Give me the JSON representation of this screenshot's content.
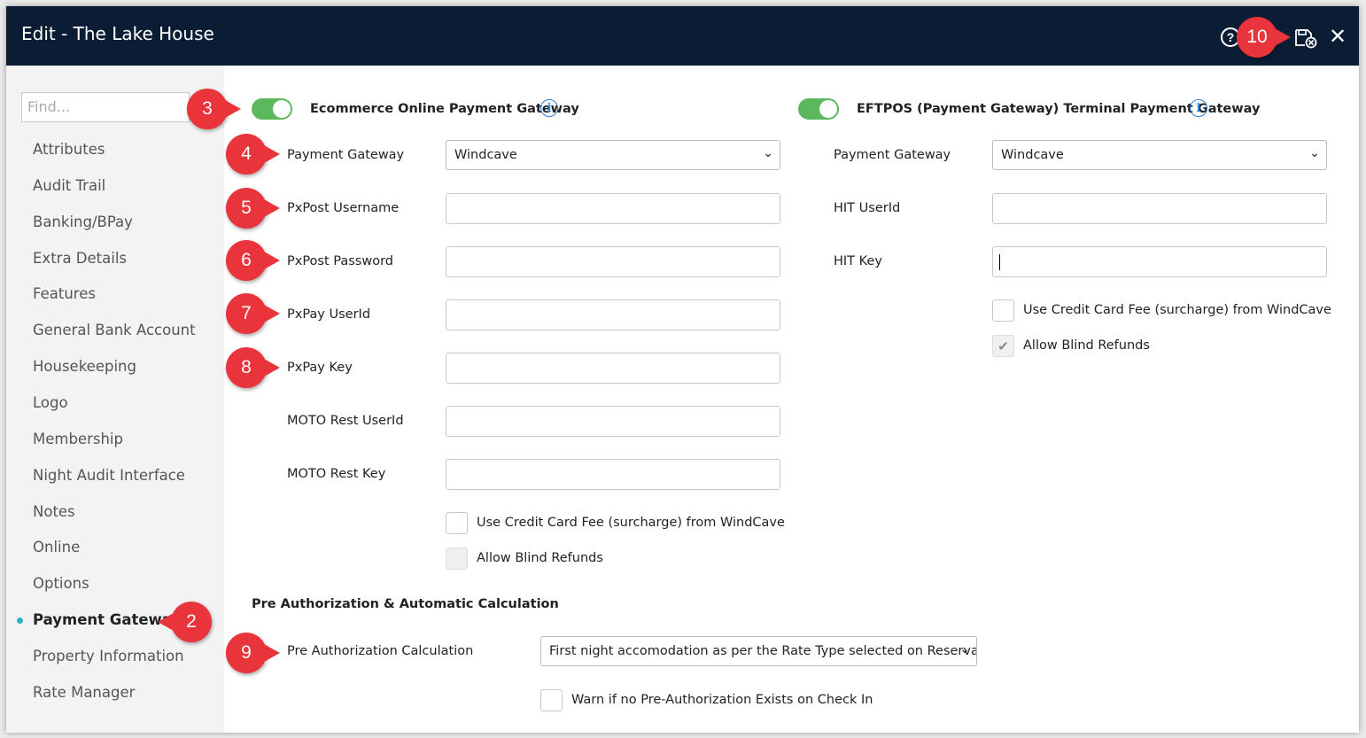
{
  "window": {
    "title": "Edit - The Lake House",
    "help_icon_glyph": "?",
    "close_icon_glyph": "✕"
  },
  "sidebar": {
    "find_placeholder": "Find...",
    "items": [
      {
        "label": "Attributes"
      },
      {
        "label": "Audit Trail"
      },
      {
        "label": "Banking/BPay"
      },
      {
        "label": "Extra Details"
      },
      {
        "label": "Features"
      },
      {
        "label": "General Bank Account"
      },
      {
        "label": "Housekeeping"
      },
      {
        "label": "Logo"
      },
      {
        "label": "Membership"
      },
      {
        "label": "Night Audit Interface"
      },
      {
        "label": "Notes"
      },
      {
        "label": "Online"
      },
      {
        "label": "Options"
      },
      {
        "label": "Payment Gateway"
      },
      {
        "label": "Property Information"
      },
      {
        "label": "Rate Manager"
      }
    ],
    "active_item": "Payment Gateway"
  },
  "ecommerce": {
    "toggle_on": true,
    "heading": "Ecommerce Online Payment Gateway",
    "payment_gateway_label": "Payment Gateway",
    "payment_gateway_value": "Windcave",
    "pxpost_username_label": "PxPost Username",
    "pxpost_password_label": "PxPost Password",
    "pxpay_userid_label": "PxPay UserId",
    "pxpay_key_label": "PxPay Key",
    "moto_userid_label": "MOTO Rest UserId",
    "moto_key_label": "MOTO Rest Key",
    "surcharge_label": "Use Credit Card Fee (surcharge) from WindCave",
    "surcharge_checked": false,
    "blind_refunds_label": "Allow Blind Refunds",
    "blind_refunds_checked": false
  },
  "eftpos": {
    "toggle_on": true,
    "heading": "EFTPOS (Payment Gateway) Terminal Payment Gateway",
    "payment_gateway_label": "Payment Gateway",
    "payment_gateway_value": "Windcave",
    "hit_userid_label": "HIT UserId",
    "hit_key_label": "HIT Key",
    "surcharge_label": "Use Credit Card Fee (surcharge) from WindCave",
    "surcharge_checked": false,
    "blind_refunds_label": "Allow Blind Refunds",
    "blind_refunds_checked": true,
    "check_glyph": "✔"
  },
  "preauth": {
    "heading": "Pre Authorization & Automatic Calculation",
    "calc_label": "Pre Authorization Calculation",
    "calc_value": "First night accomodation as per the Rate Type selected on Reservation",
    "warn_label": "Warn if no Pre-Authorization Exists on Check In",
    "warn_checked": false
  },
  "annotations": [
    "2",
    "3",
    "4",
    "5",
    "6",
    "7",
    "8",
    "9",
    "10"
  ],
  "colors": {
    "titlebar": "#0b1d35",
    "toggle_on": "#5cb85c",
    "badge": "#e8343a",
    "info": "#2a7fd4",
    "active_dot": "#2bb3c0"
  }
}
